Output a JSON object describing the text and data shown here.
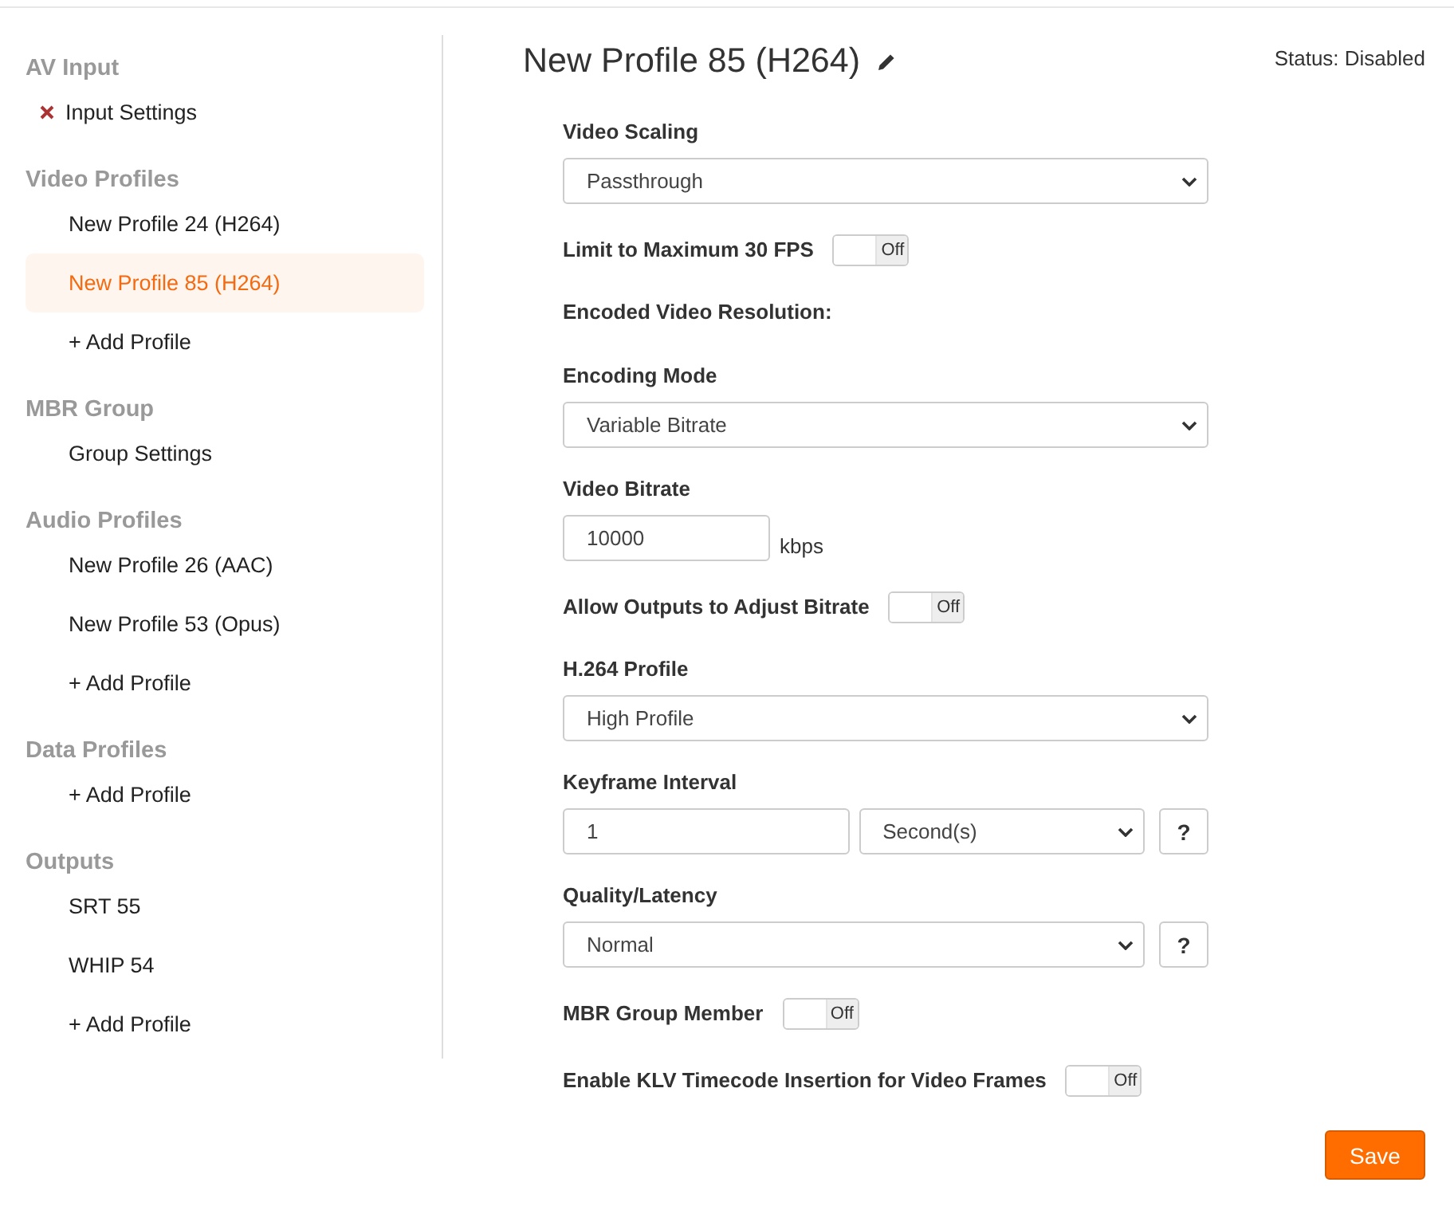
{
  "sidebar": {
    "sections": [
      {
        "title": "AV Input",
        "items": [
          {
            "label": "Input Settings",
            "kind": "error",
            "selected": false
          }
        ]
      },
      {
        "title": "Video Profiles",
        "items": [
          {
            "label": "New Profile 24 (H264)",
            "kind": "plain",
            "selected": false
          },
          {
            "label": "New Profile 85 (H264)",
            "kind": "plain",
            "selected": true
          },
          {
            "label": "+ Add Profile",
            "kind": "plain",
            "selected": false
          }
        ]
      },
      {
        "title": "MBR Group",
        "items": [
          {
            "label": "Group Settings",
            "kind": "plain",
            "selected": false
          }
        ]
      },
      {
        "title": "Audio Profiles",
        "items": [
          {
            "label": "New Profile 26 (AAC)",
            "kind": "plain",
            "selected": false
          },
          {
            "label": "New Profile 53 (Opus)",
            "kind": "plain",
            "selected": false
          },
          {
            "label": "+ Add Profile",
            "kind": "plain",
            "selected": false
          }
        ]
      },
      {
        "title": "Data Profiles",
        "items": [
          {
            "label": "+ Add Profile",
            "kind": "plain",
            "selected": false
          }
        ]
      },
      {
        "title": "Outputs",
        "items": [
          {
            "label": "SRT 55",
            "kind": "plain",
            "selected": false
          },
          {
            "label": "WHIP 54",
            "kind": "plain",
            "selected": false
          },
          {
            "label": "+ Add Profile",
            "kind": "plain",
            "selected": false
          }
        ]
      }
    ]
  },
  "page": {
    "title": "New Profile 85 (H264)",
    "status": "Status: Disabled"
  },
  "fields": [
    {
      "kind": "select",
      "label": "Video Scaling",
      "value": "Passthrough"
    },
    {
      "kind": "toggle",
      "label": "Limit to Maximum 30 FPS",
      "on": false,
      "state_text": "Off"
    },
    {
      "kind": "heading",
      "label": "Encoded Video Resolution:"
    },
    {
      "kind": "select",
      "label": "Encoding Mode",
      "value": "Variable Bitrate"
    },
    {
      "kind": "number",
      "label": "Video Bitrate",
      "value": "10000",
      "unit": "kbps"
    },
    {
      "kind": "toggle",
      "label": "Allow Outputs to Adjust Bitrate",
      "on": false,
      "state_text": "Off"
    },
    {
      "kind": "select",
      "label": "H.264 Profile",
      "value": "High Profile"
    },
    {
      "kind": "interval",
      "label": "Keyframe Interval",
      "value": "1",
      "unit_value": "Second(s)",
      "help": "?"
    },
    {
      "kind": "select_help",
      "label": "Quality/Latency",
      "value": "Normal",
      "help": "?"
    },
    {
      "kind": "toggle",
      "label": "MBR Group Member",
      "on": false,
      "state_text": "Off"
    },
    {
      "kind": "toggle",
      "label": "Enable KLV Timecode Insertion for Video Frames",
      "on": false,
      "state_text": "Off"
    }
  ],
  "save_button": "Save"
}
